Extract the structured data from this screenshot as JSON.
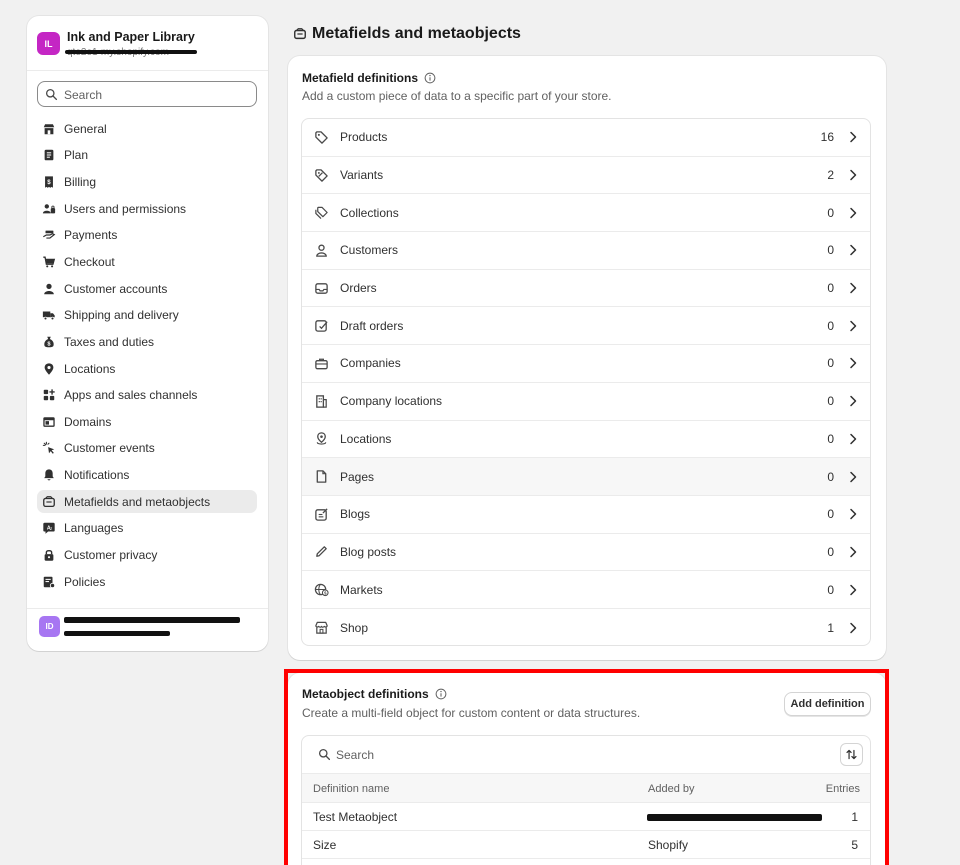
{
  "store": {
    "avatar": "IL",
    "name": "Ink and Paper Library",
    "url": "qte2e1-my.shopify.com"
  },
  "search": {
    "placeholder": "Search"
  },
  "nav": [
    {
      "label": "General",
      "icon": "store-icon"
    },
    {
      "label": "Plan",
      "icon": "plan-icon"
    },
    {
      "label": "Billing",
      "icon": "receipt-icon"
    },
    {
      "label": "Users and permissions",
      "icon": "users-icon"
    },
    {
      "label": "Payments",
      "icon": "payment-hand-icon"
    },
    {
      "label": "Checkout",
      "icon": "cart-icon"
    },
    {
      "label": "Customer accounts",
      "icon": "person-icon"
    },
    {
      "label": "Shipping and delivery",
      "icon": "truck-icon"
    },
    {
      "label": "Taxes and duties",
      "icon": "money-bag-icon"
    },
    {
      "label": "Locations",
      "icon": "location-pin-icon"
    },
    {
      "label": "Apps and sales channels",
      "icon": "apps-icon"
    },
    {
      "label": "Domains",
      "icon": "domain-icon"
    },
    {
      "label": "Customer events",
      "icon": "cursor-click-icon"
    },
    {
      "label": "Notifications",
      "icon": "bell-icon"
    },
    {
      "label": "Metafields and metaobjects",
      "icon": "metafields-icon",
      "active": true
    },
    {
      "label": "Languages",
      "icon": "translate-icon"
    },
    {
      "label": "Customer privacy",
      "icon": "lock-icon"
    },
    {
      "label": "Policies",
      "icon": "policy-icon"
    }
  ],
  "user": {
    "avatar": "ID"
  },
  "page": {
    "title": "Metafields and metaobjects"
  },
  "metafields": {
    "title": "Metafield definitions",
    "subtitle": "Add a custom piece of data to a specific part of your store.",
    "rows": [
      {
        "label": "Products",
        "count": "16",
        "icon": "tag-icon"
      },
      {
        "label": "Variants",
        "count": "2",
        "icon": "variant-tag-icon"
      },
      {
        "label": "Collections",
        "count": "0",
        "icon": "collection-tags-icon"
      },
      {
        "label": "Customers",
        "count": "0",
        "icon": "person-outline-icon"
      },
      {
        "label": "Orders",
        "count": "0",
        "icon": "inbox-icon"
      },
      {
        "label": "Draft orders",
        "count": "0",
        "icon": "draft-order-icon"
      },
      {
        "label": "Companies",
        "count": "0",
        "icon": "briefcase-icon"
      },
      {
        "label": "Company locations",
        "count": "0",
        "icon": "building-icon"
      },
      {
        "label": "Locations",
        "count": "0",
        "icon": "location-outline-icon"
      },
      {
        "label": "Pages",
        "count": "0",
        "icon": "page-icon"
      },
      {
        "label": "Blogs",
        "count": "0",
        "icon": "blog-icon"
      },
      {
        "label": "Blog posts",
        "count": "0",
        "icon": "pencil-icon"
      },
      {
        "label": "Markets",
        "count": "0",
        "icon": "globe-dollar-icon"
      },
      {
        "label": "Shop",
        "count": "1",
        "icon": "shop-icon"
      }
    ]
  },
  "metaobjects": {
    "title": "Metaobject definitions",
    "subtitle": "Create a multi-field object for custom content or data structures.",
    "add_button": "Add definition",
    "search_placeholder": "Search",
    "columns": {
      "name": "Definition name",
      "added_by": "Added by",
      "entries": "Entries"
    },
    "rows": [
      {
        "name": "Test Metaobject",
        "added_by": "",
        "entries": "1"
      },
      {
        "name": "Size",
        "added_by": "Shopify",
        "entries": "5"
      }
    ]
  }
}
